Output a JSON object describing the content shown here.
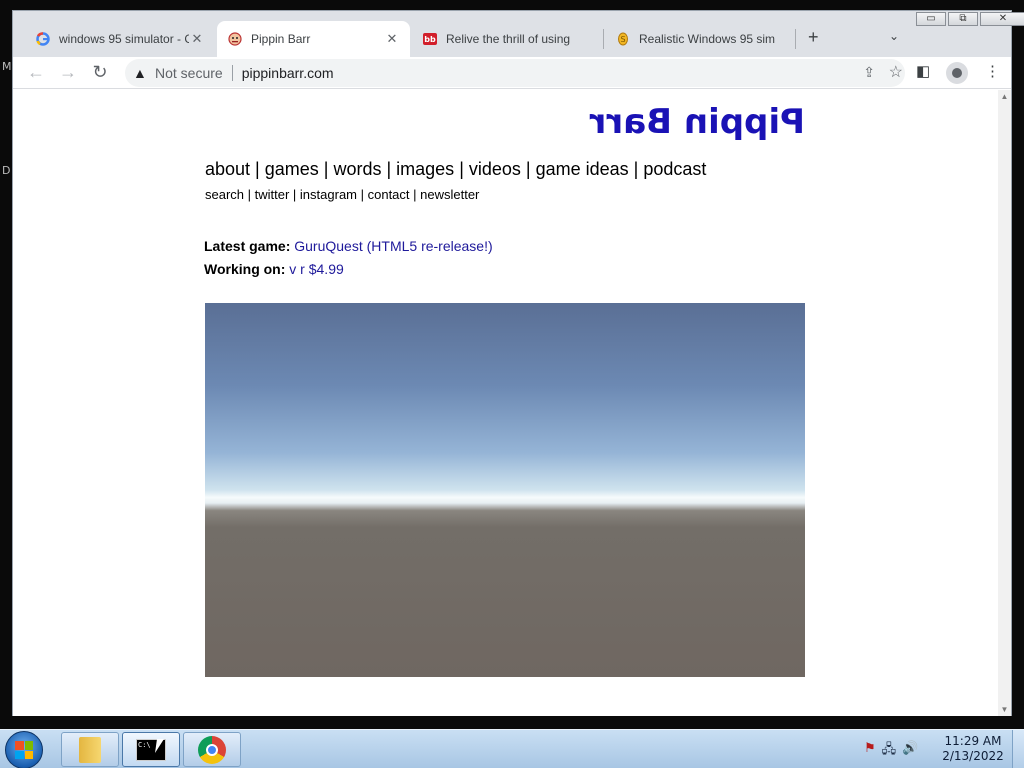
{
  "desktop": {
    "side_letters": [
      "M",
      "D"
    ]
  },
  "browser": {
    "tabs": [
      {
        "title": "windows 95 simulator - G",
        "favicon": "google-icon"
      },
      {
        "title": "Pippin Barr",
        "favicon": "pippin-face-icon",
        "active": true
      },
      {
        "title": "Relive the thrill of using",
        "favicon": "bb-icon"
      },
      {
        "title": "Realistic Windows 95 sim",
        "favicon": "coin-icon"
      }
    ],
    "new_tab_label": "+",
    "tab_close_label": "✕",
    "address": {
      "security_label": "Not secure",
      "url": "pippinbarr.com"
    },
    "window_controls": {
      "minimize": "▭",
      "restore": "⧉",
      "close": "✕"
    }
  },
  "page": {
    "site_title": "Pippin Barr",
    "main_nav": [
      "about",
      "games",
      "words",
      "images",
      "videos",
      "game ideas",
      "podcast"
    ],
    "sub_nav": [
      "search",
      "twitter",
      "instagram",
      "contact",
      "newsletter"
    ],
    "latest_game": {
      "label": "Latest game:",
      "value": "GuruQuest (HTML5 re-release!)"
    },
    "working_on": {
      "label": "Working on:",
      "value": "v r $4.99"
    }
  },
  "taskbar": {
    "apps": [
      "file-explorer-icon",
      "command-prompt-icon",
      "chrome-icon"
    ],
    "cmd_text": "C:\\",
    "clock": {
      "time": "11:29 AM",
      "date": "2/13/2022"
    }
  },
  "colors": {
    "title_blue": "#1a12b5",
    "link_blue": "#1f1a9b",
    "taskbar": "#b8d2ec"
  }
}
